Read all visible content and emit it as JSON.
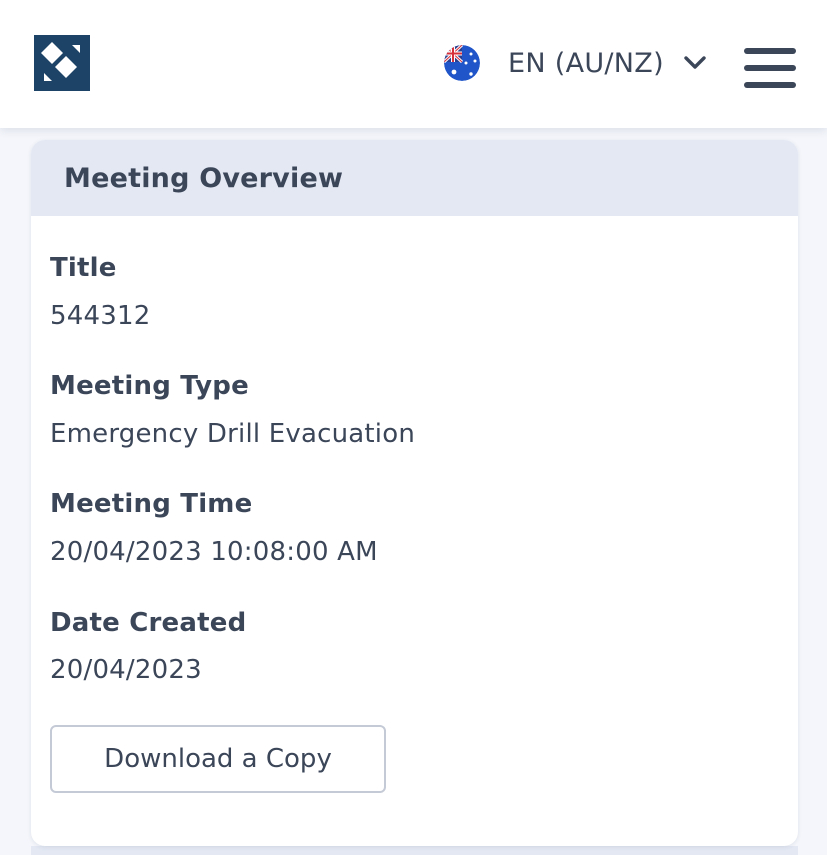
{
  "header": {
    "logo_name": "logo-icon",
    "language": {
      "flag_icon": "australia-flag-icon",
      "label": "EN (AU/NZ)",
      "dropdown_icon": "chevron-down-icon"
    },
    "menu_icon": "hamburger-menu-icon"
  },
  "overview": {
    "title": "Meeting Overview",
    "fields": [
      {
        "label": "Title",
        "value": "544312"
      },
      {
        "label": "Meeting Type",
        "value": "Emergency Drill Evacuation"
      },
      {
        "label": "Meeting Time",
        "value": "20/04/2023 10:08:00 AM"
      },
      {
        "label": "Date Created",
        "value": "20/04/2023"
      }
    ],
    "download_label": "Download a Copy"
  },
  "colors": {
    "brand_navy": "#1d4466",
    "text": "#3b4659",
    "header_band": "#e3e8f3",
    "page_background": "#f4f6fb"
  }
}
